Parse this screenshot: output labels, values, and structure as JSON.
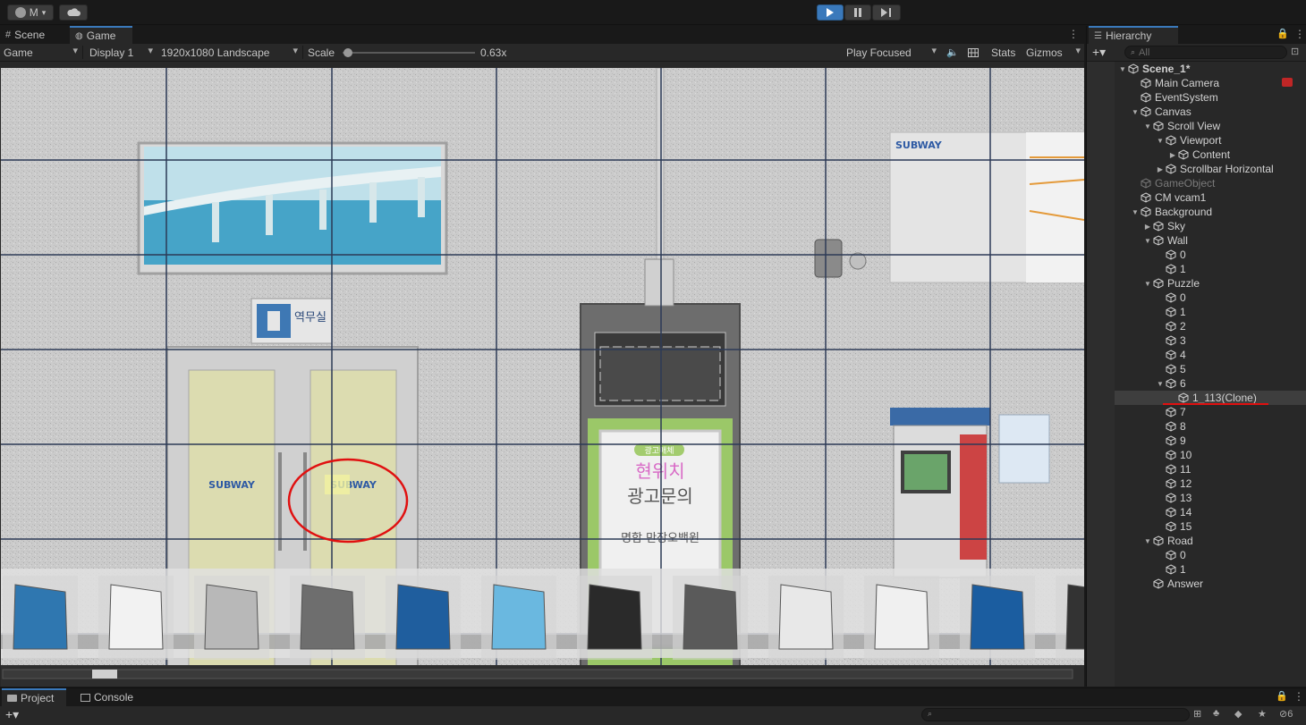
{
  "toolbar": {
    "account": "M",
    "play_icon": "play-icon",
    "pause_icon": "pause-icon",
    "step_icon": "step-icon"
  },
  "tabs": {
    "scene": "Scene",
    "game": "Game"
  },
  "game_toolbar": {
    "mode": "Game",
    "display": "Display 1",
    "resolution": "1920x1080 Landscape",
    "scale_label": "Scale",
    "scale_value": "0.63x",
    "play_focused": "Play Focused",
    "stats": "Stats",
    "gizmos": "Gizmos",
    "scale_fraction": 0.02
  },
  "viewport": {
    "subway_brand": "SUBWAY",
    "room_sign": "역무실",
    "ad_badge": "광고매체",
    "ad_title1": "현위치",
    "ad_title2": "광고문의",
    "ad_line": "명함 만장오백원"
  },
  "hierarchy": {
    "title": "Hierarchy",
    "search_placeholder": "All",
    "items": [
      {
        "label": "Scene_1*",
        "depth": 0,
        "arrow": "▼",
        "type": "scene"
      },
      {
        "label": "Main Camera",
        "depth": 1,
        "arrow": "",
        "type": "obj"
      },
      {
        "label": "EventSystem",
        "depth": 1,
        "arrow": "",
        "type": "obj"
      },
      {
        "label": "Canvas",
        "depth": 1,
        "arrow": "▼",
        "type": "obj"
      },
      {
        "label": "Scroll View",
        "depth": 2,
        "arrow": "▼",
        "type": "obj"
      },
      {
        "label": "Viewport",
        "depth": 3,
        "arrow": "▼",
        "type": "obj"
      },
      {
        "label": "Content",
        "depth": 4,
        "arrow": "▶",
        "type": "obj"
      },
      {
        "label": "Scrollbar Horizontal",
        "depth": 3,
        "arrow": "▶",
        "type": "obj"
      },
      {
        "label": "GameObject",
        "depth": 1,
        "arrow": "",
        "type": "obj",
        "disabled": true
      },
      {
        "label": "CM vcam1",
        "depth": 1,
        "arrow": "",
        "type": "obj"
      },
      {
        "label": "Background",
        "depth": 1,
        "arrow": "▼",
        "type": "obj"
      },
      {
        "label": "Sky",
        "depth": 2,
        "arrow": "▶",
        "type": "obj"
      },
      {
        "label": "Wall",
        "depth": 2,
        "arrow": "▼",
        "type": "obj"
      },
      {
        "label": "0",
        "depth": 3,
        "arrow": "",
        "type": "obj"
      },
      {
        "label": "1",
        "depth": 3,
        "arrow": "",
        "type": "obj"
      },
      {
        "label": "Puzzle",
        "depth": 2,
        "arrow": "▼",
        "type": "obj"
      },
      {
        "label": "0",
        "depth": 3,
        "arrow": "",
        "type": "obj"
      },
      {
        "label": "1",
        "depth": 3,
        "arrow": "",
        "type": "obj"
      },
      {
        "label": "2",
        "depth": 3,
        "arrow": "",
        "type": "obj"
      },
      {
        "label": "3",
        "depth": 3,
        "arrow": "",
        "type": "obj"
      },
      {
        "label": "4",
        "depth": 3,
        "arrow": "",
        "type": "obj"
      },
      {
        "label": "5",
        "depth": 3,
        "arrow": "",
        "type": "obj"
      },
      {
        "label": "6",
        "depth": 3,
        "arrow": "▼",
        "type": "obj"
      },
      {
        "label": "1_113(Clone)",
        "depth": 4,
        "arrow": "",
        "type": "obj",
        "selected": true
      },
      {
        "label": "7",
        "depth": 3,
        "arrow": "",
        "type": "obj"
      },
      {
        "label": "8",
        "depth": 3,
        "arrow": "",
        "type": "obj"
      },
      {
        "label": "9",
        "depth": 3,
        "arrow": "",
        "type": "obj"
      },
      {
        "label": "10",
        "depth": 3,
        "arrow": "",
        "type": "obj"
      },
      {
        "label": "11",
        "depth": 3,
        "arrow": "",
        "type": "obj"
      },
      {
        "label": "12",
        "depth": 3,
        "arrow": "",
        "type": "obj"
      },
      {
        "label": "13",
        "depth": 3,
        "arrow": "",
        "type": "obj"
      },
      {
        "label": "14",
        "depth": 3,
        "arrow": "",
        "type": "obj"
      },
      {
        "label": "15",
        "depth": 3,
        "arrow": "",
        "type": "obj"
      },
      {
        "label": "Road",
        "depth": 2,
        "arrow": "▼",
        "type": "obj"
      },
      {
        "label": "0",
        "depth": 3,
        "arrow": "",
        "type": "obj"
      },
      {
        "label": "1",
        "depth": 3,
        "arrow": "",
        "type": "obj"
      },
      {
        "label": "Answer",
        "depth": 2,
        "arrow": "",
        "type": "obj"
      }
    ]
  },
  "bottom": {
    "project": "Project",
    "console": "Console",
    "hidden_count": "6"
  },
  "colors": {
    "accent": "#3a79bb",
    "annotation": "#e01010",
    "panel": "#282828"
  }
}
